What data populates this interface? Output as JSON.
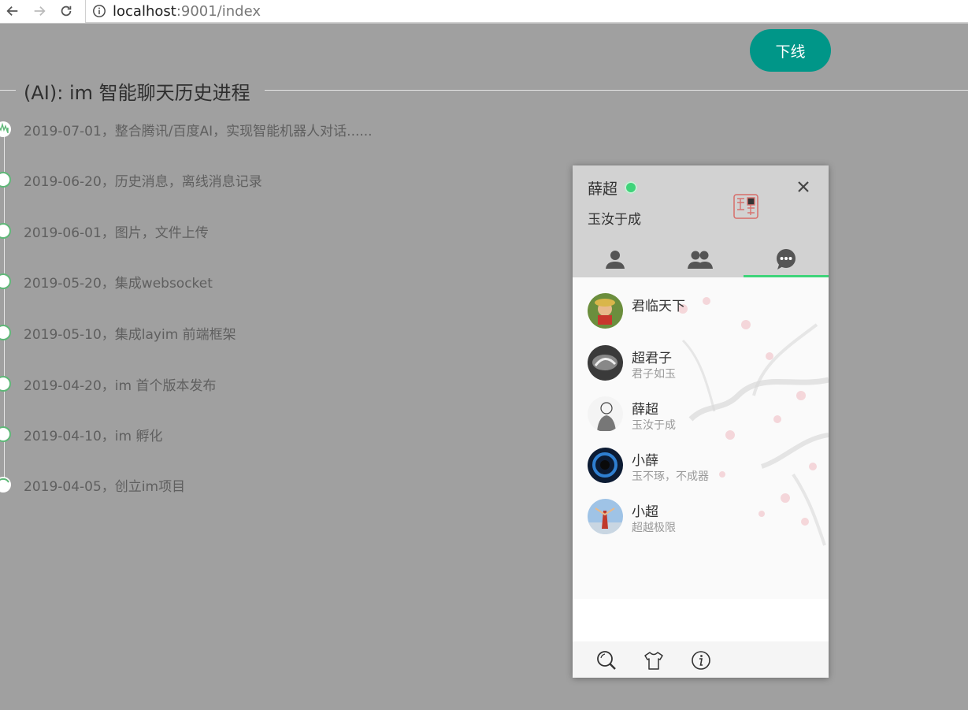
{
  "browser": {
    "url_host": "localhost",
    "url_path": ":9001/index"
  },
  "page": {
    "logout_label": "下线"
  },
  "timeline": {
    "title": "(AI): im 智能聊天历史进程",
    "items": [
      {
        "text": "2019-07-01，整合腾讯/百度AI，实现智能机器人对话......"
      },
      {
        "text": "2019-06-20，历史消息，离线消息记录"
      },
      {
        "text": "2019-06-01，图片，文件上传"
      },
      {
        "text": "2019-05-20，集成websocket"
      },
      {
        "text": "2019-05-10，集成layim 前端框架"
      },
      {
        "text": "2019-04-20，im 首个版本发布"
      },
      {
        "text": "2019-04-10，im 孵化"
      },
      {
        "text": "2019-04-05，创立im项目"
      }
    ]
  },
  "im": {
    "username": "薛超",
    "status": "online",
    "sign": "玉汝于成",
    "tabs": [
      {
        "name": "friends",
        "icon": "person-icon"
      },
      {
        "name": "groups",
        "icon": "group-icon"
      },
      {
        "name": "history",
        "icon": "chat-bubble-icon",
        "active": true
      }
    ],
    "history": [
      {
        "name": "君临天下",
        "sign": ""
      },
      {
        "name": "超君子",
        "sign": "君子如玉"
      },
      {
        "name": "薛超",
        "sign": "玉汝于成"
      },
      {
        "name": "小薛",
        "sign": "玉不琢，不成器"
      },
      {
        "name": "小超",
        "sign": "超越极限"
      }
    ],
    "toolbar": [
      "search-icon",
      "skin-icon",
      "about-icon"
    ]
  },
  "colors": {
    "accent": "#009688",
    "online": "#3fd47a",
    "timeline_node": "#5FB878",
    "overlay": "#a0a0a0"
  }
}
